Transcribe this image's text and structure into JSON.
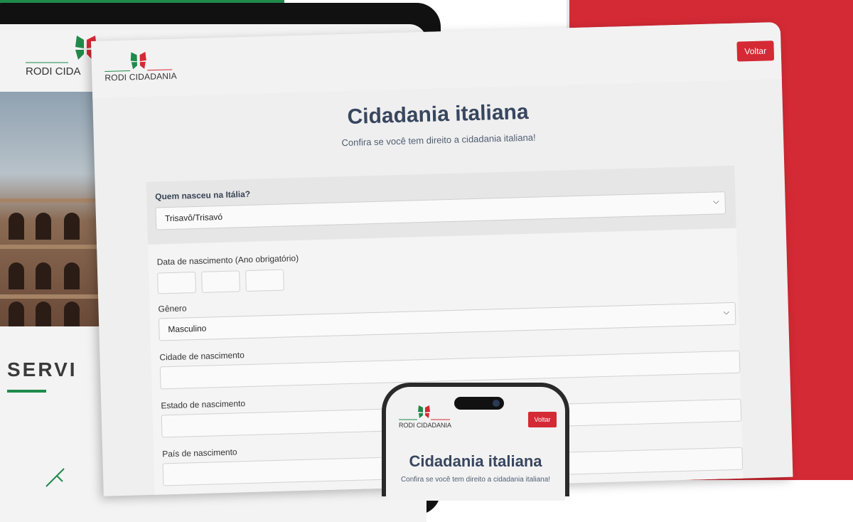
{
  "brand": {
    "name": "RODI CIDADANIA",
    "name_truncated": "RODI CIDA",
    "colors": {
      "red": "#d42a35",
      "green": "#1f8a4a",
      "title": "#38465f"
    }
  },
  "tablet": {
    "section_heading": "SERVI"
  },
  "header": {
    "back_button": "Voltar"
  },
  "page": {
    "title": "Cidadania italiana",
    "subtitle": "Confira se você tem direito a cidadania italiana!"
  },
  "form": {
    "italian_born_label": "Quem nasceu na Itália?",
    "italian_born_value": "Trisavô/Trisavó",
    "birth_date_label": "Data de nascimento (Ano obrigatório)",
    "gender_label": "Gênero",
    "gender_value": "Masculino",
    "birth_city_label": "Cidade de nascimento",
    "birth_state_label": "Estado de nascimento",
    "birth_country_label": "País de nascimento"
  },
  "icons": {
    "select_chevron": "chevron-down-icon",
    "logo": "butterfly-logo-icon"
  }
}
